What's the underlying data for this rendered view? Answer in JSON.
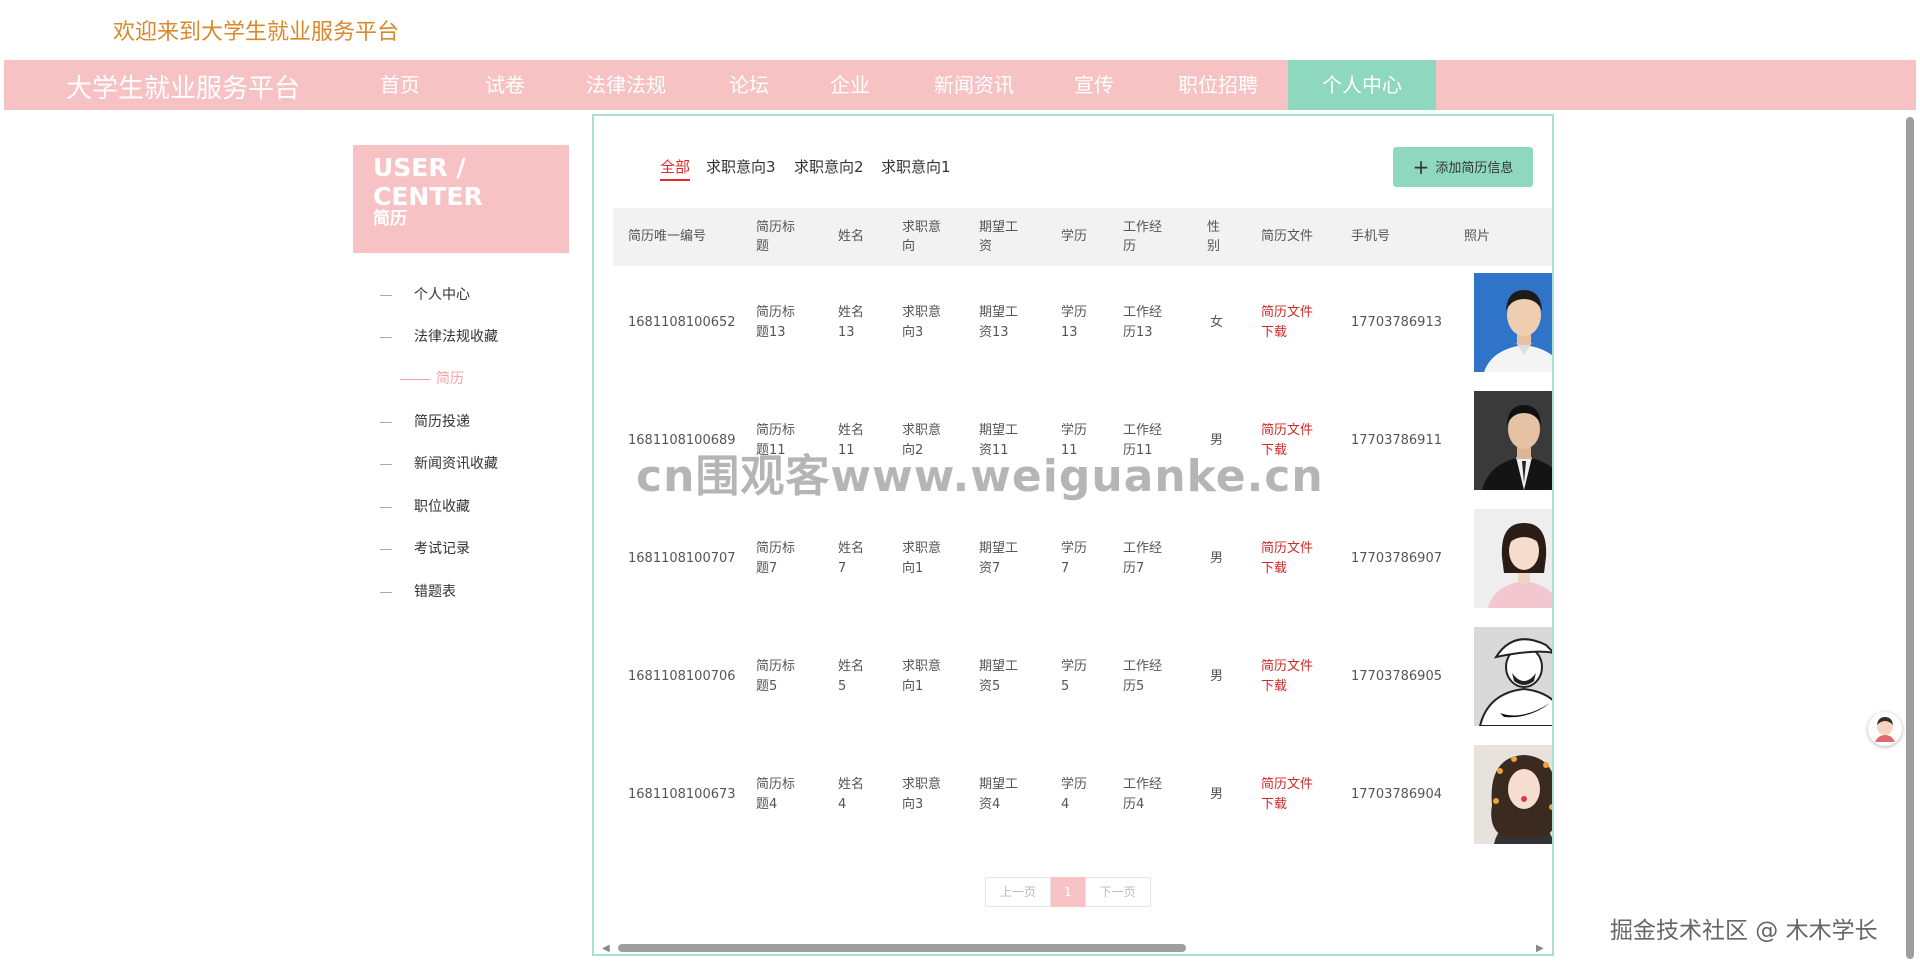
{
  "header": {
    "welcome": "欢迎来到大学生就业服务平台",
    "brand": "大学生就业服务平台",
    "nav": [
      "首页",
      "试卷",
      "法律法规",
      "论坛",
      "企业",
      "新闻资讯",
      "宣传",
      "职位招聘",
      "个人中心"
    ],
    "active_nav": "个人中心"
  },
  "sidebar": {
    "title": "USER / CENTER",
    "subtitle": "简历",
    "items": [
      "个人中心",
      "法律法规收藏",
      "简历",
      "简历投递",
      "新闻资讯收藏",
      "职位收藏",
      "考试记录",
      "错题表"
    ],
    "active_item": "简历"
  },
  "main": {
    "tabs": [
      "全部",
      "求职意向3",
      "求职意向2",
      "求职意向1"
    ],
    "active_tab": "全部",
    "add_button": "添加简历信息",
    "columns": [
      "简历唯一编号",
      "简历标题",
      "姓名",
      "求职意向",
      "期望工资",
      "学历",
      "工作经历",
      "性别",
      "简历文件",
      "手机号",
      "照片"
    ],
    "rows": [
      {
        "id": "1681108100652",
        "title": "简历标题13",
        "name": "姓名13",
        "intent": "求职意向3",
        "salary": "期望工资13",
        "edu": "学历13",
        "exp": "工作经历13",
        "gender": "女",
        "file": "简历文件下载",
        "phone": "17703786913",
        "photo": "man-blue-bg"
      },
      {
        "id": "1681108100689",
        "title": "简历标题11",
        "name": "姓名11",
        "intent": "求职意向2",
        "salary": "期望工资11",
        "edu": "学历11",
        "exp": "工作经历11",
        "gender": "男",
        "file": "简历文件下载",
        "phone": "17703786911",
        "photo": "man-dark-suit"
      },
      {
        "id": "1681108100707",
        "title": "简历标题7",
        "name": "姓名7",
        "intent": "求职意向1",
        "salary": "期望工资7",
        "edu": "学历7",
        "exp": "工作经历7",
        "gender": "男",
        "file": "简历文件下载",
        "phone": "17703786907",
        "photo": "woman-pink"
      },
      {
        "id": "1681108100706",
        "title": "简历标题5",
        "name": "姓名5",
        "intent": "求职意向1",
        "salary": "期望工资5",
        "edu": "学历5",
        "exp": "工作经历5",
        "gender": "男",
        "file": "简历文件下载",
        "phone": "17703786905",
        "photo": "cartoon-cap"
      },
      {
        "id": "1681108100673",
        "title": "简历标题4",
        "name": "姓名4",
        "intent": "求职意向3",
        "salary": "期望工资4",
        "edu": "学历4",
        "exp": "工作经历4",
        "gender": "男",
        "file": "简历文件下载",
        "phone": "17703786904",
        "photo": "woman-curly"
      }
    ],
    "pagination": {
      "prev": "上一页",
      "current": "1",
      "next": "下一页"
    }
  },
  "overlay": {
    "watermark": "cn围观客www.weiguanke.cn",
    "credit": "掘金技术社区 @ 木木学长"
  },
  "colors": {
    "brand_pink": "#f7c2c3",
    "accent_green": "#8fd8c0",
    "link_red": "#d12828",
    "welcome_orange": "#d9892b"
  }
}
